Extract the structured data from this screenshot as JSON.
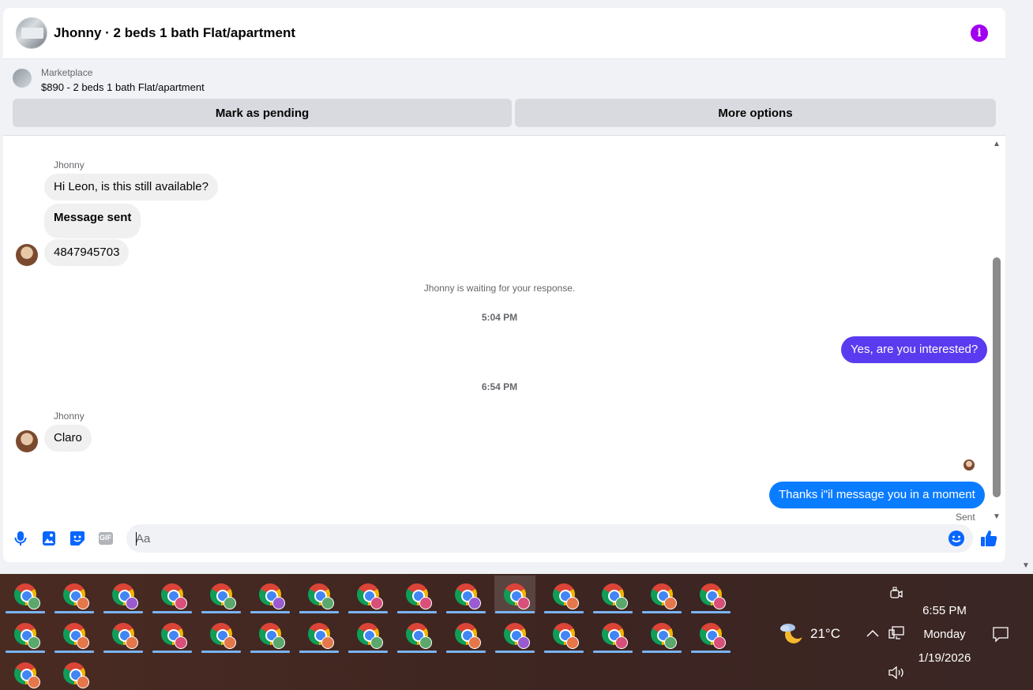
{
  "chat": {
    "header_title": "Jhonny · 2 beds 1 bath Flat/apartment",
    "listing": {
      "source": "Marketplace",
      "price_line": "$890 - 2 beds 1 bath Flat/apartment",
      "mark_pending_label": "Mark as pending",
      "more_options_label": "More options"
    },
    "messages": [
      {
        "sender": "Jhonny",
        "text": "Hi Leon, is this still available?"
      },
      {
        "text": "Message sent"
      },
      {
        "text": "4847945703"
      },
      {
        "system": "Jhonny is waiting for your response."
      },
      {
        "time": "5:04 PM"
      },
      {
        "text": "Yes, are you interested?"
      },
      {
        "time": "6:54 PM"
      },
      {
        "sender": "Jhonny",
        "text": "Claro"
      },
      {
        "text": "Thanks i\"il message you in a moment",
        "status": "Sent"
      }
    ],
    "composer": {
      "placeholder": "Aa",
      "gif_label": "GIF"
    }
  },
  "colors": {
    "accent_purple": "#a100f2",
    "outgoing_purple": "#5b3bf0",
    "outgoing_blue": "#0a7cff",
    "messenger_blue": "#0866ff"
  },
  "taskbar": {
    "rows": [
      [
        "green",
        "orange",
        "purple",
        "pink",
        "green",
        "purple",
        "green",
        "pink",
        "pink",
        "purple",
        "pink",
        "orange",
        "green",
        "orange",
        "pink"
      ],
      [
        "green",
        "orange",
        "orange",
        "pink",
        "orange",
        "green",
        "orange",
        "green",
        "green",
        "orange",
        "purple",
        "orange",
        "pink",
        "green",
        "pink"
      ],
      [
        "orange",
        "orange"
      ]
    ],
    "active_item": "row1-11",
    "weather": {
      "temp": "21°C",
      "icon": "moon-cloud-icon"
    },
    "clock": {
      "time": "6:55 PM",
      "day": "Monday",
      "date": "1/19/2026"
    }
  }
}
